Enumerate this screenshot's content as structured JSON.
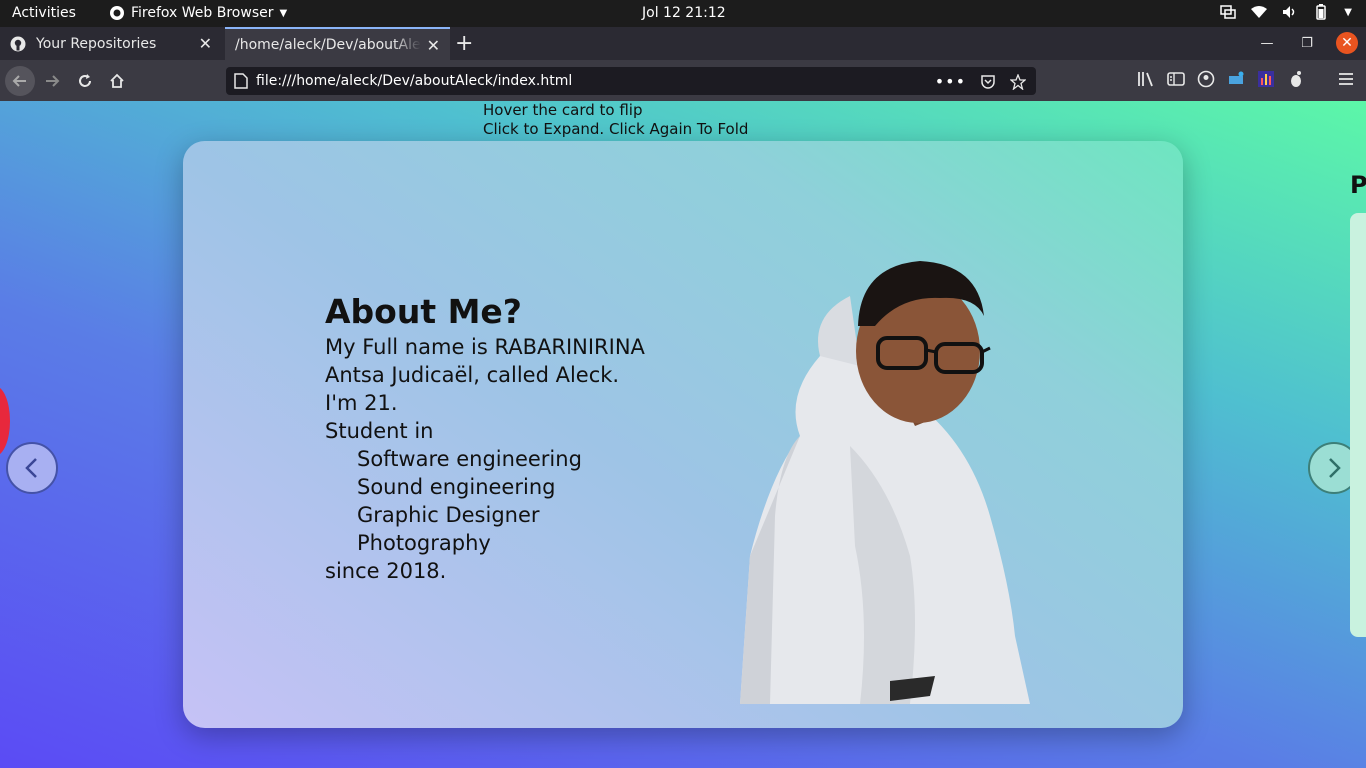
{
  "topbar": {
    "activities": "Activities",
    "app_name": "Firefox Web Browser",
    "clock": "Jol 12  21:12"
  },
  "tabs": [
    {
      "label": "Your Repositories",
      "active": false
    },
    {
      "label": "/home/aleck/Dev/aboutAleck/index.html",
      "active": true
    }
  ],
  "navbar": {
    "url": "file:///home/aleck/Dev/aboutAleck/index.html"
  },
  "page": {
    "hint_line1": "Hover the card to flip",
    "hint_line2": "Click to Expand. Click Again To Fold",
    "about_title": "About Me?",
    "about_lines": [
      "My Full name is RABARINIRINA",
      "Antsa Judicaël, called Aleck.",
      "I'm 21.",
      "Student in"
    ],
    "fields": [
      "Software engineering",
      "Sound engineering",
      "Graphic Designer",
      "Photography"
    ],
    "since": "since 2018.",
    "next_card_title_partial": "P",
    "prev_icon": "<",
    "next_icon": ">"
  },
  "colors": {
    "accent_close": "#e95420",
    "page_gradient_start": "#5b4bf5",
    "page_gradient_end": "#5cf7a8"
  }
}
